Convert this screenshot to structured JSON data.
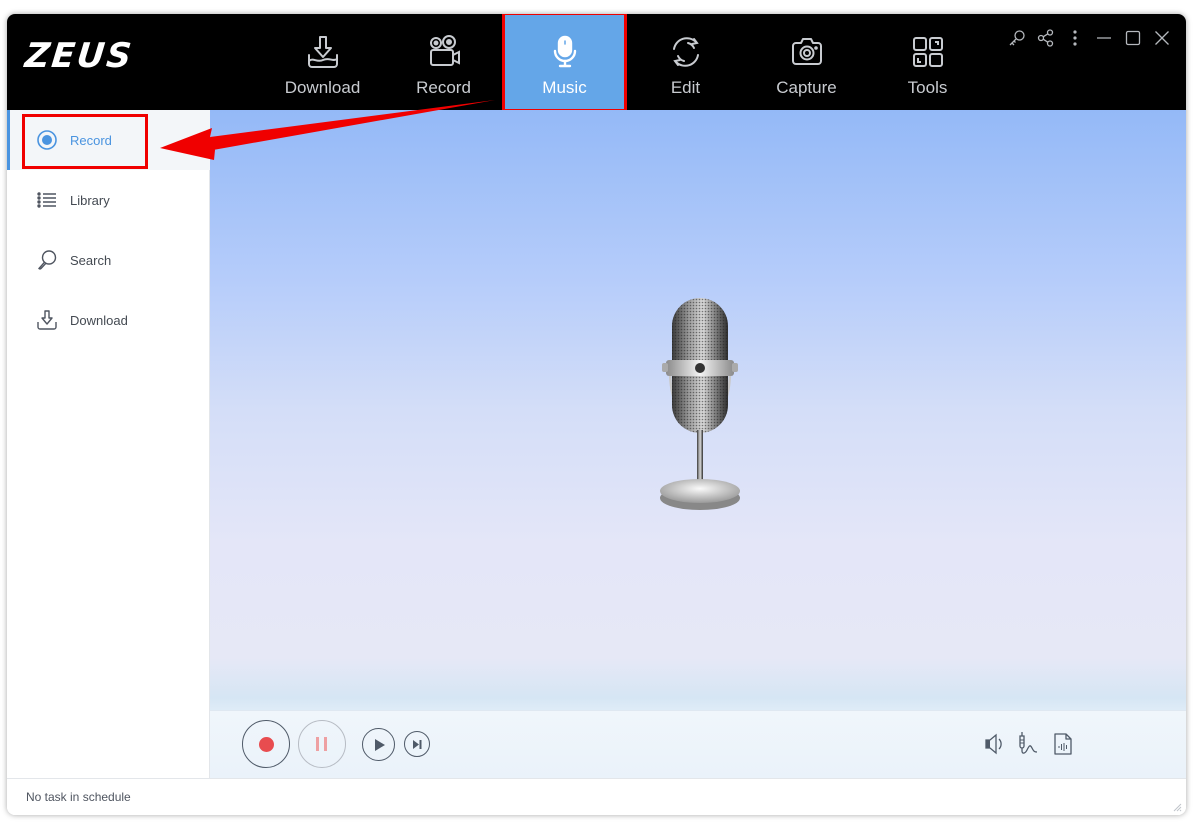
{
  "app": {
    "logo": "ZEUS"
  },
  "nav": {
    "tabs": [
      {
        "label": "Download",
        "icon": "download-tray-icon",
        "active": false
      },
      {
        "label": "Record",
        "icon": "video-camera-icon",
        "active": false
      },
      {
        "label": "Music",
        "icon": "microphone-icon",
        "active": true
      },
      {
        "label": "Edit",
        "icon": "refresh-cycle-icon",
        "active": false
      },
      {
        "label": "Capture",
        "icon": "camera-icon",
        "active": false
      },
      {
        "label": "Tools",
        "icon": "tools-grid-icon",
        "active": false
      }
    ]
  },
  "window_controls": [
    "key-icon",
    "share-icon",
    "more-icon",
    "minimize-icon",
    "maximize-icon",
    "close-icon"
  ],
  "sidebar": {
    "items": [
      {
        "label": "Record",
        "icon": "radio-record-icon",
        "active": true
      },
      {
        "label": "Library",
        "icon": "list-icon",
        "active": false
      },
      {
        "label": "Search",
        "icon": "search-icon",
        "active": false
      },
      {
        "label": "Download",
        "icon": "download-icon",
        "active": false
      }
    ]
  },
  "player": {
    "buttons": [
      "record",
      "pause",
      "play",
      "skip-next"
    ],
    "tools": [
      "speaker-icon",
      "audio-jack-icon",
      "audio-file-icon"
    ]
  },
  "status": {
    "text": "No task in schedule"
  },
  "colors": {
    "accent": "#64a6e8",
    "sidebar_active": "#4a94e0",
    "annotation_red": "#f00000",
    "record_red": "#e84c4f"
  }
}
